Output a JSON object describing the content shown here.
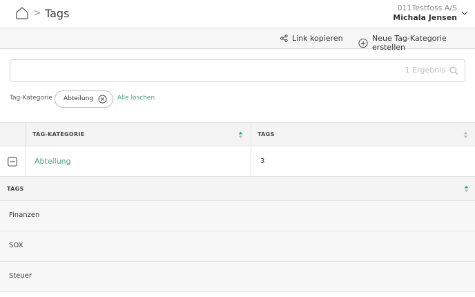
{
  "header": {
    "title": "Tags",
    "separator": ">",
    "company": "011Testfoss A/S",
    "user": "Michala Jensen"
  },
  "toolbar": {
    "link_label": "Link kopieren",
    "new_label": "Neue Tag-Kategorie erstellen"
  },
  "search": {
    "value": "",
    "result_count": "1 Ergebnis"
  },
  "filters": {
    "label": "Tag-Kategorie",
    "chip": "Abteilung",
    "clear_all": "Alle löschen"
  },
  "table": {
    "columns": [
      "TAG-KATEGORIE",
      "TAGS"
    ],
    "rows": [
      {
        "category": "Abteilung",
        "tags": "3"
      }
    ]
  },
  "subtable": {
    "header": "TAGS",
    "rows": [
      "Finanzen",
      "SOX",
      "Steuer"
    ]
  },
  "colors": {
    "accent": "#3fa37a",
    "sort_active": "#3fa37a",
    "sort_inactive": "#c0c0c0"
  },
  "icons": {
    "home": "home-icon",
    "share": "share-icon",
    "add": "plus-circle-icon",
    "search": "search-icon",
    "chip_close": "close-circle-icon",
    "collapse": "minus-square-icon",
    "user_menu": "chevron-down-icon"
  }
}
